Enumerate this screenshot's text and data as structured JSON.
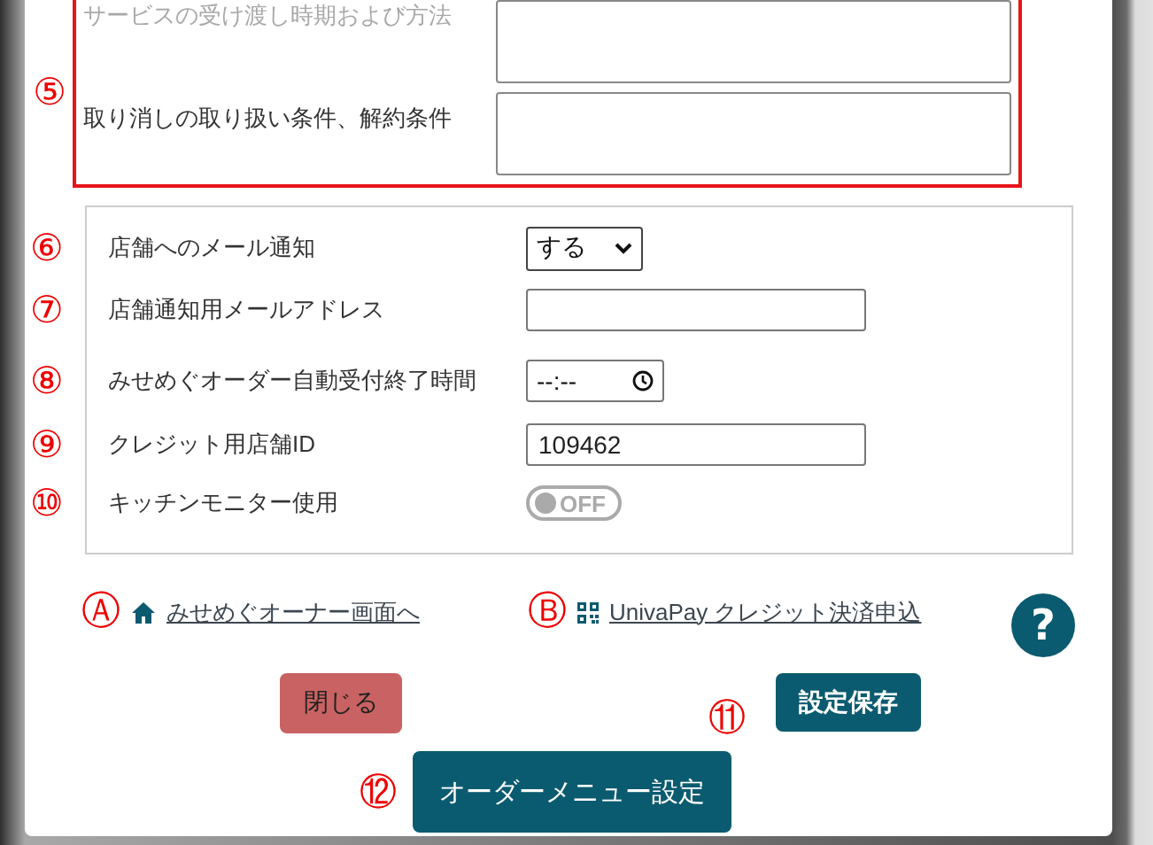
{
  "terms_section": {
    "marker": "⑤",
    "fields": [
      {
        "label": "サービスの受け渡し時期および方法",
        "faded": true
      },
      {
        "label": "取り消しの取り扱い条件、解約条件",
        "faded": false
      }
    ]
  },
  "settings": [
    {
      "marker": "⑥",
      "kind": "select",
      "label": "店舗へのメール通知",
      "value": "する"
    },
    {
      "marker": "⑦",
      "kind": "text",
      "label": "店舗通知用メールアドレス"
    },
    {
      "marker": "⑧",
      "kind": "time",
      "label": "みせめぐオーダー自動受付終了時間",
      "value": "--:--"
    },
    {
      "marker": "⑨",
      "kind": "text",
      "label": "クレジット用店舗ID",
      "value": "109462"
    },
    {
      "marker": "⑩",
      "kind": "toggle",
      "label": "キッチンモニター使用",
      "on": false,
      "text": "OFF"
    }
  ],
  "links": [
    {
      "marker": "Ⓐ",
      "kind": "home",
      "text": "みせめぐオーナー画面へ"
    },
    {
      "marker": "Ⓑ",
      "kind": "qr",
      "text": "UnivaPay クレジット決済申込"
    }
  ],
  "help_button": {
    "label": "?"
  },
  "buttons": [
    {
      "kind": "close",
      "label": "閉じる"
    },
    {
      "kind": "save",
      "label": "設定保存",
      "marker": "⑪"
    },
    {
      "kind": "menu",
      "label": "オーダーメニュー設定",
      "marker": "⑫"
    }
  ]
}
